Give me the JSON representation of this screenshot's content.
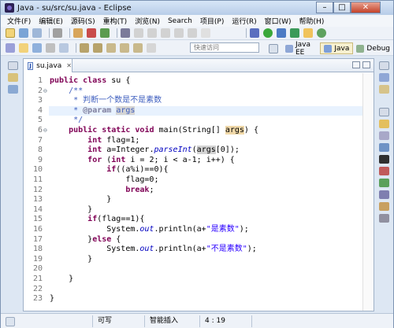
{
  "window": {
    "title": "Java - su/src/su.java - Eclipse"
  },
  "menu": [
    "文件(F)",
    "编辑(E)",
    "源码(S)",
    "重构(T)",
    "浏览(N)",
    "Search",
    "项目(P)",
    "运行(R)",
    "窗口(W)",
    "帮助(H)"
  ],
  "toolbar": {
    "quick_access": "快速访问",
    "perspectives": [
      {
        "label": "Java EE",
        "active": false
      },
      {
        "label": "Java",
        "active": true
      },
      {
        "label": "Debug",
        "active": false
      }
    ]
  },
  "editor": {
    "tab_label": "su.java",
    "tab_close": "✕",
    "lines": [
      {
        "n": "1",
        "fold": "",
        "html": "<span class=\"kw\">public</span> <span class=\"kw\">class</span> su {"
      },
      {
        "n": "2",
        "fold": "⊖",
        "html": "    <span class=\"cm\">/**</span>"
      },
      {
        "n": "3",
        "fold": "",
        "html": "<span class=\"cm\">     * 判断一个数是不是素数</span>"
      },
      {
        "n": "4",
        "fold": "",
        "html": "<span class=\"cm\">     * </span><span class=\"tag\">@param</span><span class=\"cm\"> </span><span class=\"cm sel2\">args</span>"
      },
      {
        "n": "5",
        "fold": "",
        "html": "<span class=\"cm\">     */</span>"
      },
      {
        "n": "6",
        "fold": "⊖",
        "html": "    <span class=\"kw\">public</span> <span class=\"kw\">static</span> <span class=\"kw\">void</span> main(String[] <span class=\"sel\">args</span>) {"
      },
      {
        "n": "7",
        "fold": "",
        "html": "        <span class=\"kw\">int</span> flag=1;"
      },
      {
        "n": "8",
        "fold": "",
        "html": "        <span class=\"kw\">int</span> a=Integer.<span class=\"it\">parseInt</span>(<span class=\"sel2\">args</span>[0]);"
      },
      {
        "n": "9",
        "fold": "",
        "html": "        <span class=\"kw\">for</span> (<span class=\"kw\">int</span> i = 2; i &lt; a-1; i++) {"
      },
      {
        "n": "10",
        "fold": "",
        "html": "            <span class=\"kw\">if</span>((a%i)==0){"
      },
      {
        "n": "11",
        "fold": "",
        "html": "                flag=0;"
      },
      {
        "n": "12",
        "fold": "",
        "html": "                <span class=\"kw\">break</span>;"
      },
      {
        "n": "13",
        "fold": "",
        "html": "            }"
      },
      {
        "n": "14",
        "fold": "",
        "html": "        }"
      },
      {
        "n": "15",
        "fold": "",
        "html": "        <span class=\"kw\">if</span>(flag==1){"
      },
      {
        "n": "16",
        "fold": "",
        "html": "            System.<span class=\"it\">out</span>.println(a+<span class=\"st\">\"是素数\"</span>);"
      },
      {
        "n": "17",
        "fold": "",
        "html": "        }<span class=\"kw\">else</span> {"
      },
      {
        "n": "18",
        "fold": "",
        "html": "            System.<span class=\"it\">out</span>.println(a+<span class=\"st\">\"不是素数\"</span>);"
      },
      {
        "n": "19",
        "fold": "",
        "html": "        }"
      },
      {
        "n": "20",
        "fold": "",
        "html": ""
      },
      {
        "n": "21",
        "fold": "",
        "html": "    }"
      },
      {
        "n": "22",
        "fold": "",
        "html": ""
      },
      {
        "n": "23",
        "fold": "",
        "html": "}"
      }
    ],
    "current_line": "4"
  },
  "status": {
    "writable": "可写",
    "insert_mode": "智能插入",
    "position": "4 : 19"
  }
}
